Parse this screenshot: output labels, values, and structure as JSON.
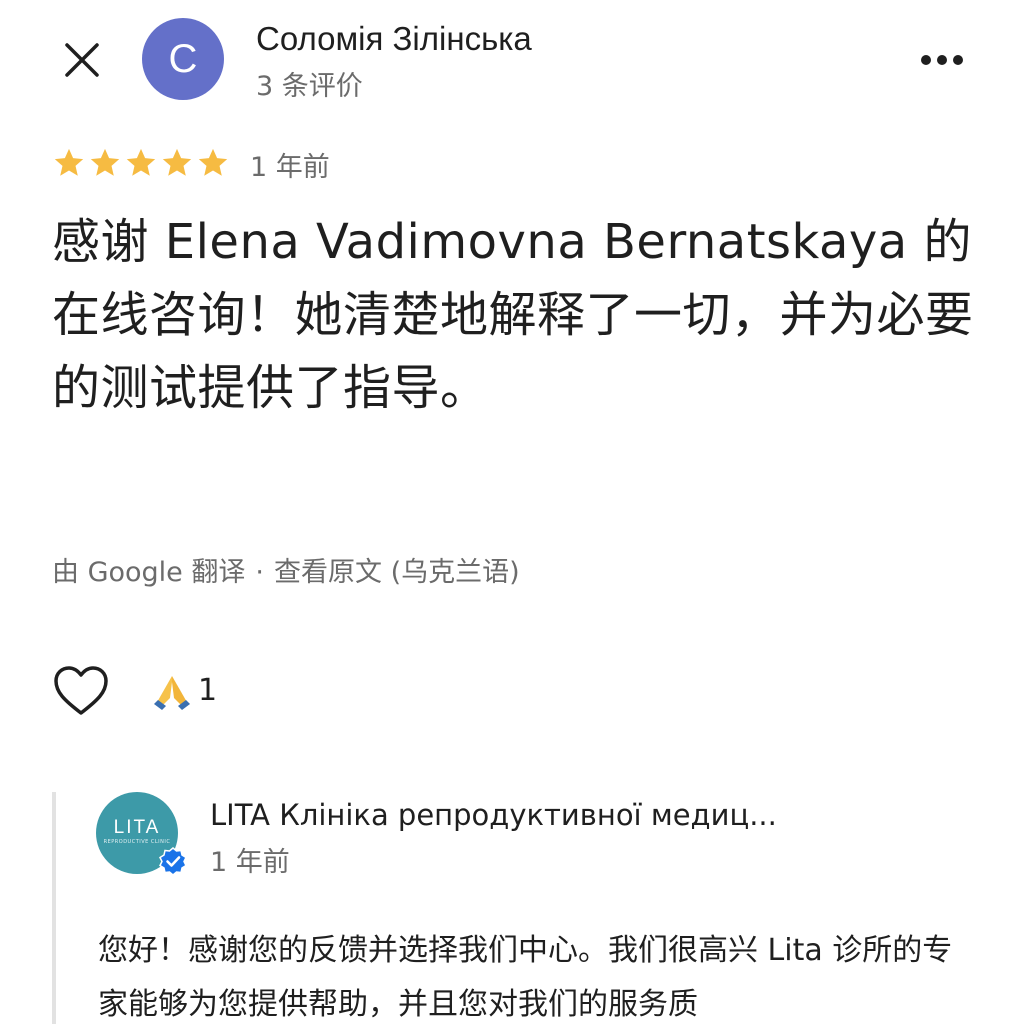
{
  "header": {
    "close_icon": "close-icon",
    "avatar_letter": "C",
    "avatar_color": "#6470c9",
    "author_name": "Соломія Зілінська",
    "author_meta": "3 条评价",
    "more_icon": "more-vert-icon"
  },
  "review": {
    "rating": 5,
    "rating_max": 5,
    "star_color": "#f6bb42",
    "time": "1 年前",
    "text": "感谢 Elena Vadimovna Bernatskaya 的在线咨询！她清楚地解释了一切，并为必要的测试提供了指导。",
    "translated_by": "由 Google 翻译",
    "separator": "·",
    "view_original": "查看原文 (乌克兰语)"
  },
  "reactions": {
    "like_icon": "heart-outline-icon",
    "emoji": "🙏",
    "emoji_count": "1"
  },
  "owner_reply": {
    "logo_text": "LITA",
    "logo_sub": "REPRODUCTIVE CLINIC",
    "logo_color": "#3d9aa8",
    "verified_icon": "verified-badge-icon",
    "name": "LITA Клініка репродуктивної медиц...",
    "time": "1 年前",
    "text": "您好！感谢您的反馈并选择我们中心。我们很高兴 Lita 诊所的专家能够为您提供帮助，并且您对我们的服务质"
  }
}
